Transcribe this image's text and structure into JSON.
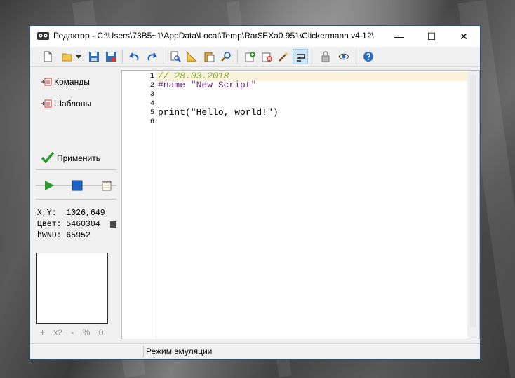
{
  "window": {
    "title": "Редактор - C:\\Users\\73B5~1\\AppData\\Local\\Temp\\Rar$EXa0.951\\Clickermann v4.12\\",
    "controls": {
      "minimize": "—",
      "maximize": "☐",
      "close": "✕"
    }
  },
  "toolbar": {
    "buttons": [
      {
        "name": "new-file-icon"
      },
      {
        "name": "open-folder-icon"
      },
      {
        "name": "dropdown-arrow-icon"
      },
      {
        "name": "save-icon"
      },
      {
        "name": "save-as-icon"
      },
      {
        "name": "undo-icon"
      },
      {
        "name": "redo-icon"
      },
      {
        "name": "find-icon"
      },
      {
        "name": "ruler-icon"
      },
      {
        "name": "paste-icon"
      },
      {
        "name": "zoom-search-icon"
      },
      {
        "name": "add-icon"
      },
      {
        "name": "delete-icon"
      },
      {
        "name": "magic-wand-icon"
      },
      {
        "name": "wrap-icon"
      },
      {
        "name": "lock-icon"
      },
      {
        "name": "eye-icon"
      },
      {
        "name": "help-icon"
      }
    ]
  },
  "sidebar": {
    "commands_label": "Команды",
    "templates_label": "Шаблоны",
    "apply_label": "Применить",
    "xy_line": "X,Y:  1026,649",
    "color_line": "Цвет: 5460304",
    "hwnd_line": "hWND: 65952",
    "swatch_color": "#4a4a4a",
    "zoom": {
      "plus": "+",
      "x2": "x2",
      "minus": "-",
      "percent": "%",
      "zero": "0"
    }
  },
  "editor": {
    "lines": [
      {
        "num": "1",
        "text": "// 28.03.2018"
      },
      {
        "num": "2",
        "text": "#name \"New Script\""
      },
      {
        "num": "3",
        "text": ""
      },
      {
        "num": "4",
        "text": ""
      },
      {
        "num": "5",
        "text": "print(\"Hello, world!\")"
      },
      {
        "num": "6",
        "text": ""
      }
    ]
  },
  "statusbar": {
    "mode": "Режим эмуляции"
  }
}
